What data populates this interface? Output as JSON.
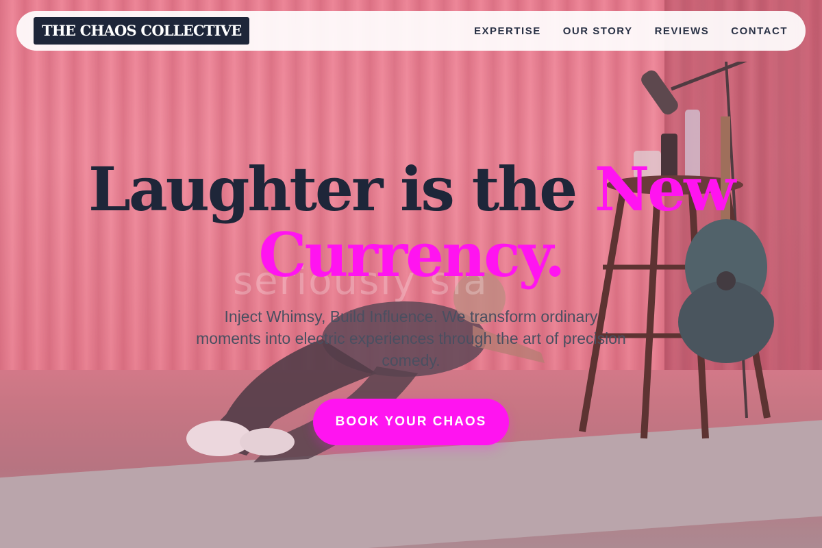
{
  "brand": {
    "logo_text": "THE CHAOS COLLECTIVE"
  },
  "nav": {
    "items": [
      {
        "label": "EXPERTISE"
      },
      {
        "label": "OUR STORY"
      },
      {
        "label": "REVIEWS"
      },
      {
        "label": "CONTACT"
      }
    ]
  },
  "hero": {
    "headline_part1": "Laughter is the ",
    "headline_accent": "New Currency.",
    "background_watermark": "seriously sia",
    "subtext": "Inject Whimsy, Build Influence. We transform ordinary moments into electric experiences through the art of precision comedy.",
    "cta_label": "BOOK YOUR CHAOS",
    "background_image": "comedian-on-stage-photo"
  },
  "colors": {
    "accent": "#ff14f0",
    "navy": "#1e2639",
    "nav_bg": "#ffffff",
    "curtain": "#e97f91"
  }
}
